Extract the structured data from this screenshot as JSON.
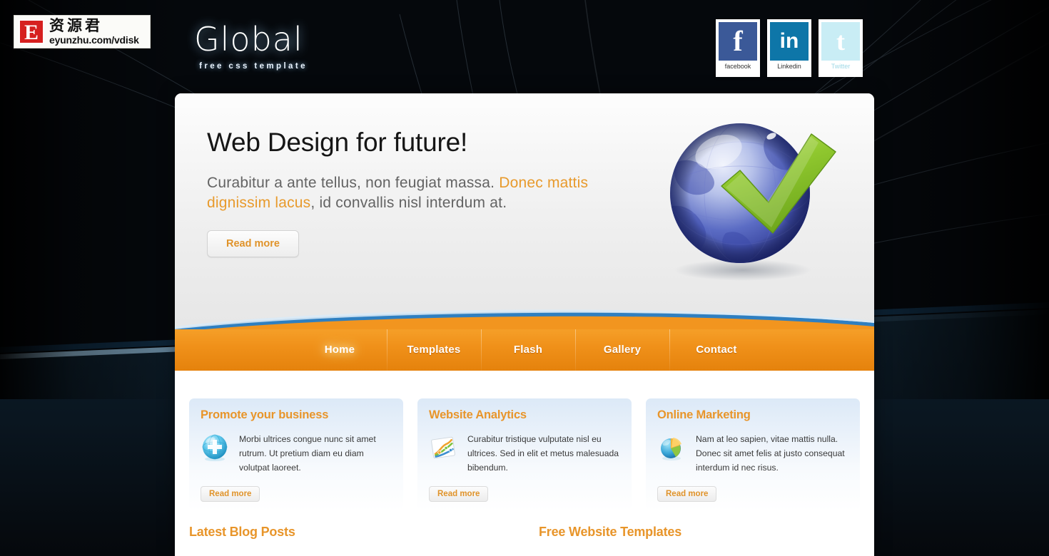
{
  "header": {
    "logo": {
      "letter": "E",
      "chinese": "资源君",
      "url": "eyunzhu.com/vdisk"
    },
    "brand_title": "Global",
    "brand_subtitle": "free css template",
    "social": [
      {
        "name": "facebook",
        "caption": "facebook",
        "glyph": "f"
      },
      {
        "name": "linkedin",
        "caption": "Linkedin",
        "glyph": "in"
      },
      {
        "name": "twitter",
        "caption": "Twitter",
        "glyph": "t"
      }
    ]
  },
  "hero": {
    "heading": "Web Design for future!",
    "text_before": "Curabitur a ante tellus, non feugiat massa. ",
    "text_accent": "Donec mattis dignissim lacus",
    "text_after": ", id convallis nisl interdum at.",
    "button": "Read more",
    "image": "globe-check-icon"
  },
  "nav": {
    "items": [
      {
        "label": "Home",
        "active": true
      },
      {
        "label": "Templates",
        "active": false
      },
      {
        "label": "Flash",
        "active": false
      },
      {
        "label": "Gallery",
        "active": false
      },
      {
        "label": "Contact",
        "active": false
      }
    ]
  },
  "features": [
    {
      "title": "Promote your business",
      "text": "Morbi ultrices congue nunc sit amet rutrum. Ut pretium diam eu diam volutpat laoreet.",
      "button": "Read more",
      "icon": "globe-plus-icon"
    },
    {
      "title": "Website Analytics",
      "text": "Curabitur tristique vulputate nisl eu ultrices. Sed in elit et metus malesuada bibendum.",
      "button": "Read more",
      "icon": "line-chart-icon"
    },
    {
      "title": "Online Marketing",
      "text": "Nam at leo sapien, vitae mattis nulla. Donec sit amet felis at justo consequat interdum id nec risus.",
      "button": "Read more",
      "icon": "pie-chart-icon"
    }
  ],
  "bottom": {
    "left_heading": "Latest Blog Posts",
    "right_heading": "Free Website Templates"
  },
  "colors": {
    "accent_orange": "#e8952a",
    "nav_orange": "#f0911a",
    "brand_blue": "#1a639c",
    "curve_blue": "#2f7fc0"
  }
}
